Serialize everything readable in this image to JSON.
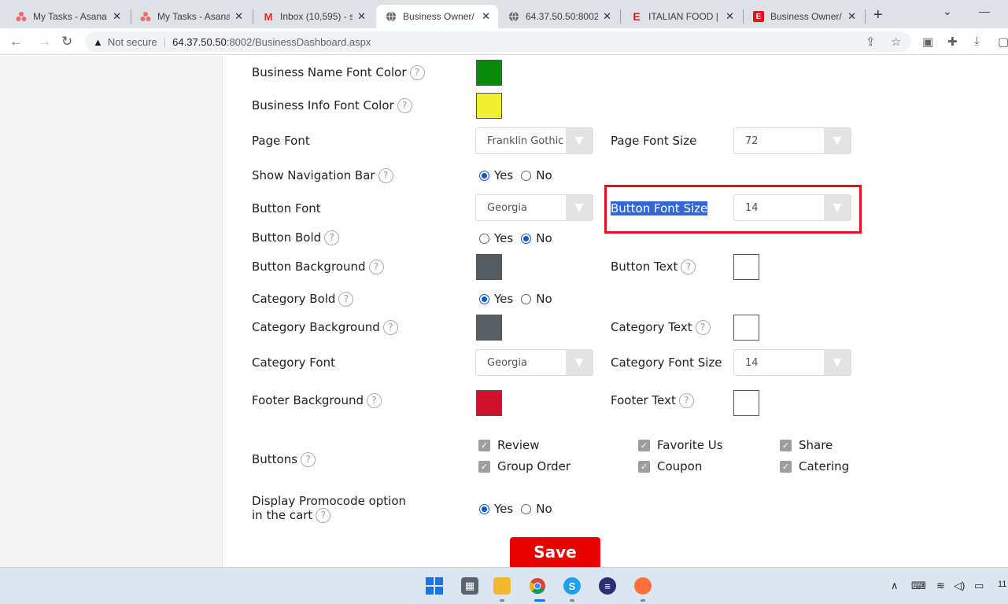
{
  "browser": {
    "tabs": [
      {
        "title": "My Tasks - Asana",
        "icon": "asana-icon"
      },
      {
        "title": "My Tasks - Asana",
        "icon": "asana-icon"
      },
      {
        "title": "Inbox (10,595) - s",
        "icon": "gmail-icon"
      },
      {
        "title": "Business Owner/",
        "icon": "globe-icon",
        "active": true
      },
      {
        "title": "64.37.50.50:8002",
        "icon": "globe-icon"
      },
      {
        "title": "ITALIAN FOOD | ",
        "icon": "e-logo-icon"
      },
      {
        "title": "Business Owner/",
        "icon": "e-logo-icon"
      }
    ],
    "security_label": "Not secure",
    "url_host": "64.37.50.50",
    "url_path": ":8002/BusinessDashboard.aspx"
  },
  "form": {
    "business_name_font_color": {
      "label": "Business Name Font Color",
      "color": "#0a8a0a"
    },
    "business_info_font_color": {
      "label": "Business Info Font Color",
      "color": "#f0f032"
    },
    "page_font": {
      "label": "Page Font",
      "value": "Franklin Gothic"
    },
    "page_font_size": {
      "label": "Page Font Size",
      "value": "72"
    },
    "show_navigation_bar": {
      "label": "Show Navigation Bar",
      "yes": "Yes",
      "no": "No",
      "selected": "Yes"
    },
    "button_font": {
      "label": "Button Font",
      "value": "Georgia"
    },
    "button_font_size": {
      "label": "Button Font Size",
      "value": "14"
    },
    "button_bold": {
      "label": "Button Bold",
      "yes": "Yes",
      "no": "No",
      "selected": "No"
    },
    "button_background": {
      "label": "Button Background",
      "color": "#545b61"
    },
    "button_text": {
      "label": "Button Text",
      "color": "#ffffff"
    },
    "category_bold": {
      "label": "Category Bold",
      "yes": "Yes",
      "no": "No",
      "selected": "Yes"
    },
    "category_background": {
      "label": "Category Background",
      "color": "#5a5f63"
    },
    "category_text": {
      "label": "Category Text",
      "color": "#ffffff"
    },
    "category_font": {
      "label": "Category Font",
      "value": "Georgia"
    },
    "category_font_size": {
      "label": "Category Font Size",
      "value": "14"
    },
    "footer_background": {
      "label": "Footer Background",
      "color": "#d0122a"
    },
    "footer_text": {
      "label": "Footer Text",
      "color": "#ffffff"
    },
    "buttons": {
      "label": "Buttons",
      "options": [
        "Review",
        "Favorite Us",
        "Share",
        "Group Order",
        "Coupon",
        "Catering"
      ]
    },
    "promocode": {
      "label_line1": "Display Promocode option",
      "label_line2": "in the cart",
      "yes": "Yes",
      "no": "No",
      "selected": "Yes"
    },
    "save_label": "Save"
  },
  "tray": {
    "time": "11"
  }
}
